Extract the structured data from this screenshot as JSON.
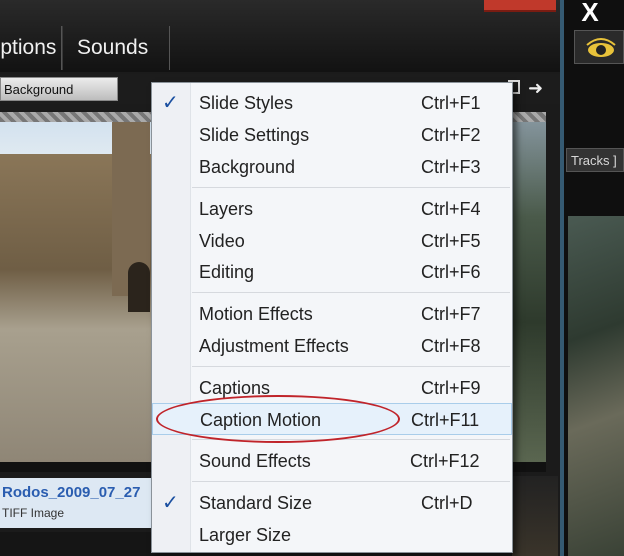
{
  "header": {
    "tabs": [
      {
        "label": "Options"
      },
      {
        "label": "Sounds"
      }
    ],
    "close_glyph": "X"
  },
  "toolbar": {
    "background_button": "Background"
  },
  "right_panel": {
    "tracks_label": "Tracks ]"
  },
  "file": {
    "name": "Rodos_2009_07_27",
    "type": "TIFF Image"
  },
  "menu": {
    "items": [
      {
        "label": "Slide Styles",
        "shortcut": "Ctrl+F1",
        "checked": true
      },
      {
        "label": "Slide Settings",
        "shortcut": "Ctrl+F2",
        "checked": false
      },
      {
        "label": "Background",
        "shortcut": "Ctrl+F3",
        "checked": false
      },
      {
        "label": "Layers",
        "shortcut": "Ctrl+F4",
        "checked": false
      },
      {
        "label": "Video",
        "shortcut": "Ctrl+F5",
        "checked": false
      },
      {
        "label": "Editing",
        "shortcut": "Ctrl+F6",
        "checked": false
      },
      {
        "label": "Motion Effects",
        "shortcut": "Ctrl+F7",
        "checked": false
      },
      {
        "label": "Adjustment Effects",
        "shortcut": "Ctrl+F8",
        "checked": false
      },
      {
        "label": "Captions",
        "shortcut": "Ctrl+F9",
        "checked": false
      },
      {
        "label": "Caption Motion",
        "shortcut": "Ctrl+F11",
        "checked": false,
        "highlighted": true
      },
      {
        "label": "Sound Effects",
        "shortcut": "Ctrl+F12",
        "checked": false
      },
      {
        "label": "Standard Size",
        "shortcut": "Ctrl+D",
        "checked": true
      },
      {
        "label": "Larger Size",
        "shortcut": "",
        "checked": false
      }
    ],
    "check_glyph": "✓",
    "highlight_color": "#c0242a"
  }
}
